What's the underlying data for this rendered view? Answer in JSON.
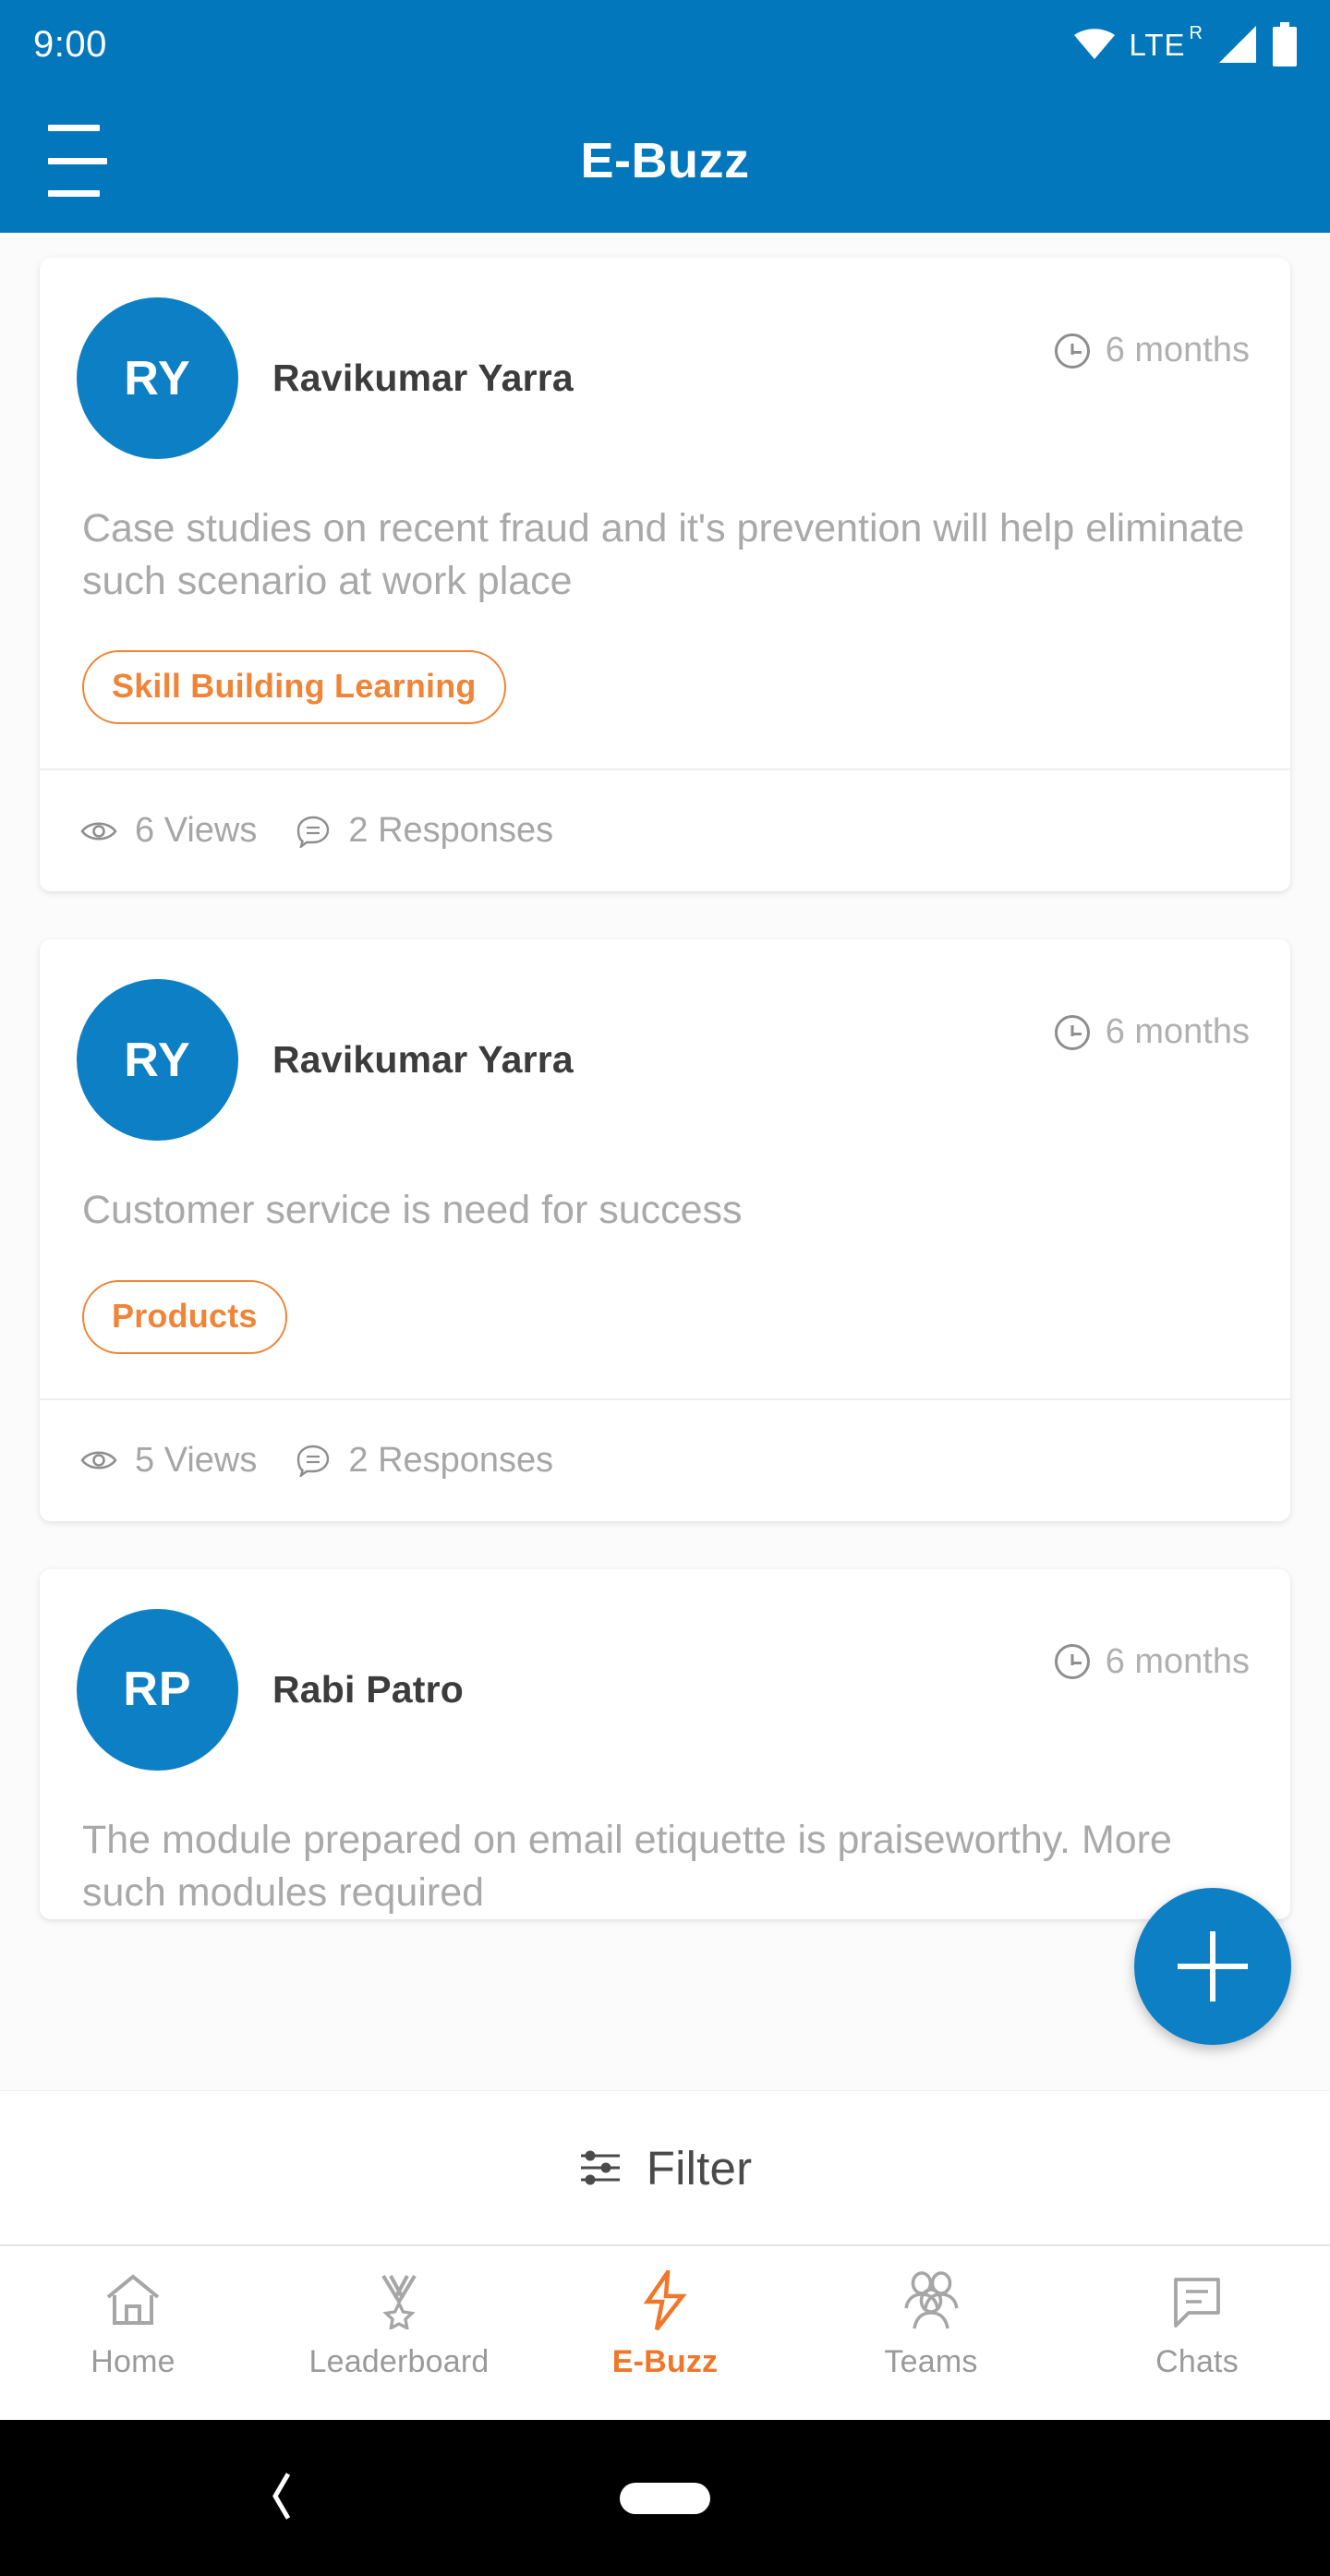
{
  "status_bar": {
    "time": "9:00",
    "network_label": "LTE",
    "network_sup": "R",
    "icons": [
      "wifi-icon",
      "signal-icon",
      "battery-icon"
    ]
  },
  "app_bar": {
    "title": "E-Buzz",
    "menu_icon": "hamburger-menu-icon"
  },
  "colors": {
    "primary_blue": "#0377bc",
    "avatar_blue": "#0d7fc4",
    "accent_orange": "#f08437",
    "nav_active_orange": "#f0772a",
    "muted_text": "#a9a9a9",
    "card_bg": "#ffffff",
    "page_bg": "#fbfbfb"
  },
  "feed": {
    "posts": [
      {
        "initials": "RY",
        "author": "Ravikumar Yarra",
        "time": "6 months",
        "text": "Case studies on recent fraud and it's prevention will help eliminate such scenario at work place",
        "tag": "Skill Building Learning",
        "views": "6 Views",
        "responses": "2 Responses"
      },
      {
        "initials": "RY",
        "author": "Ravikumar Yarra",
        "time": "6 months",
        "text": "Customer service is need for success",
        "tag": "Products",
        "views": "5 Views",
        "responses": "2 Responses"
      },
      {
        "initials": "RP",
        "author": "Rabi Patro",
        "time": "6 months",
        "text": "The module prepared on email etiquette is praiseworthy. More such modules required",
        "tag": "",
        "views": "",
        "responses": ""
      }
    ]
  },
  "fab": {
    "label": "+",
    "icon": "plus-icon"
  },
  "filter_bar": {
    "label": "Filter",
    "icon": "tune-sliders-icon"
  },
  "bottom_nav": {
    "items": [
      {
        "label": "Home",
        "icon": "home-icon",
        "active": false
      },
      {
        "label": "Leaderboard",
        "icon": "medal-icon",
        "active": false
      },
      {
        "label": "E-Buzz",
        "icon": "lightning-icon",
        "active": true
      },
      {
        "label": "Teams",
        "icon": "people-group-icon",
        "active": false
      },
      {
        "label": "Chats",
        "icon": "chat-bubble-icon",
        "active": false
      }
    ]
  },
  "android_nav": {
    "back_icon": "back-chevron-icon",
    "home_icon": "home-pill-icon"
  }
}
